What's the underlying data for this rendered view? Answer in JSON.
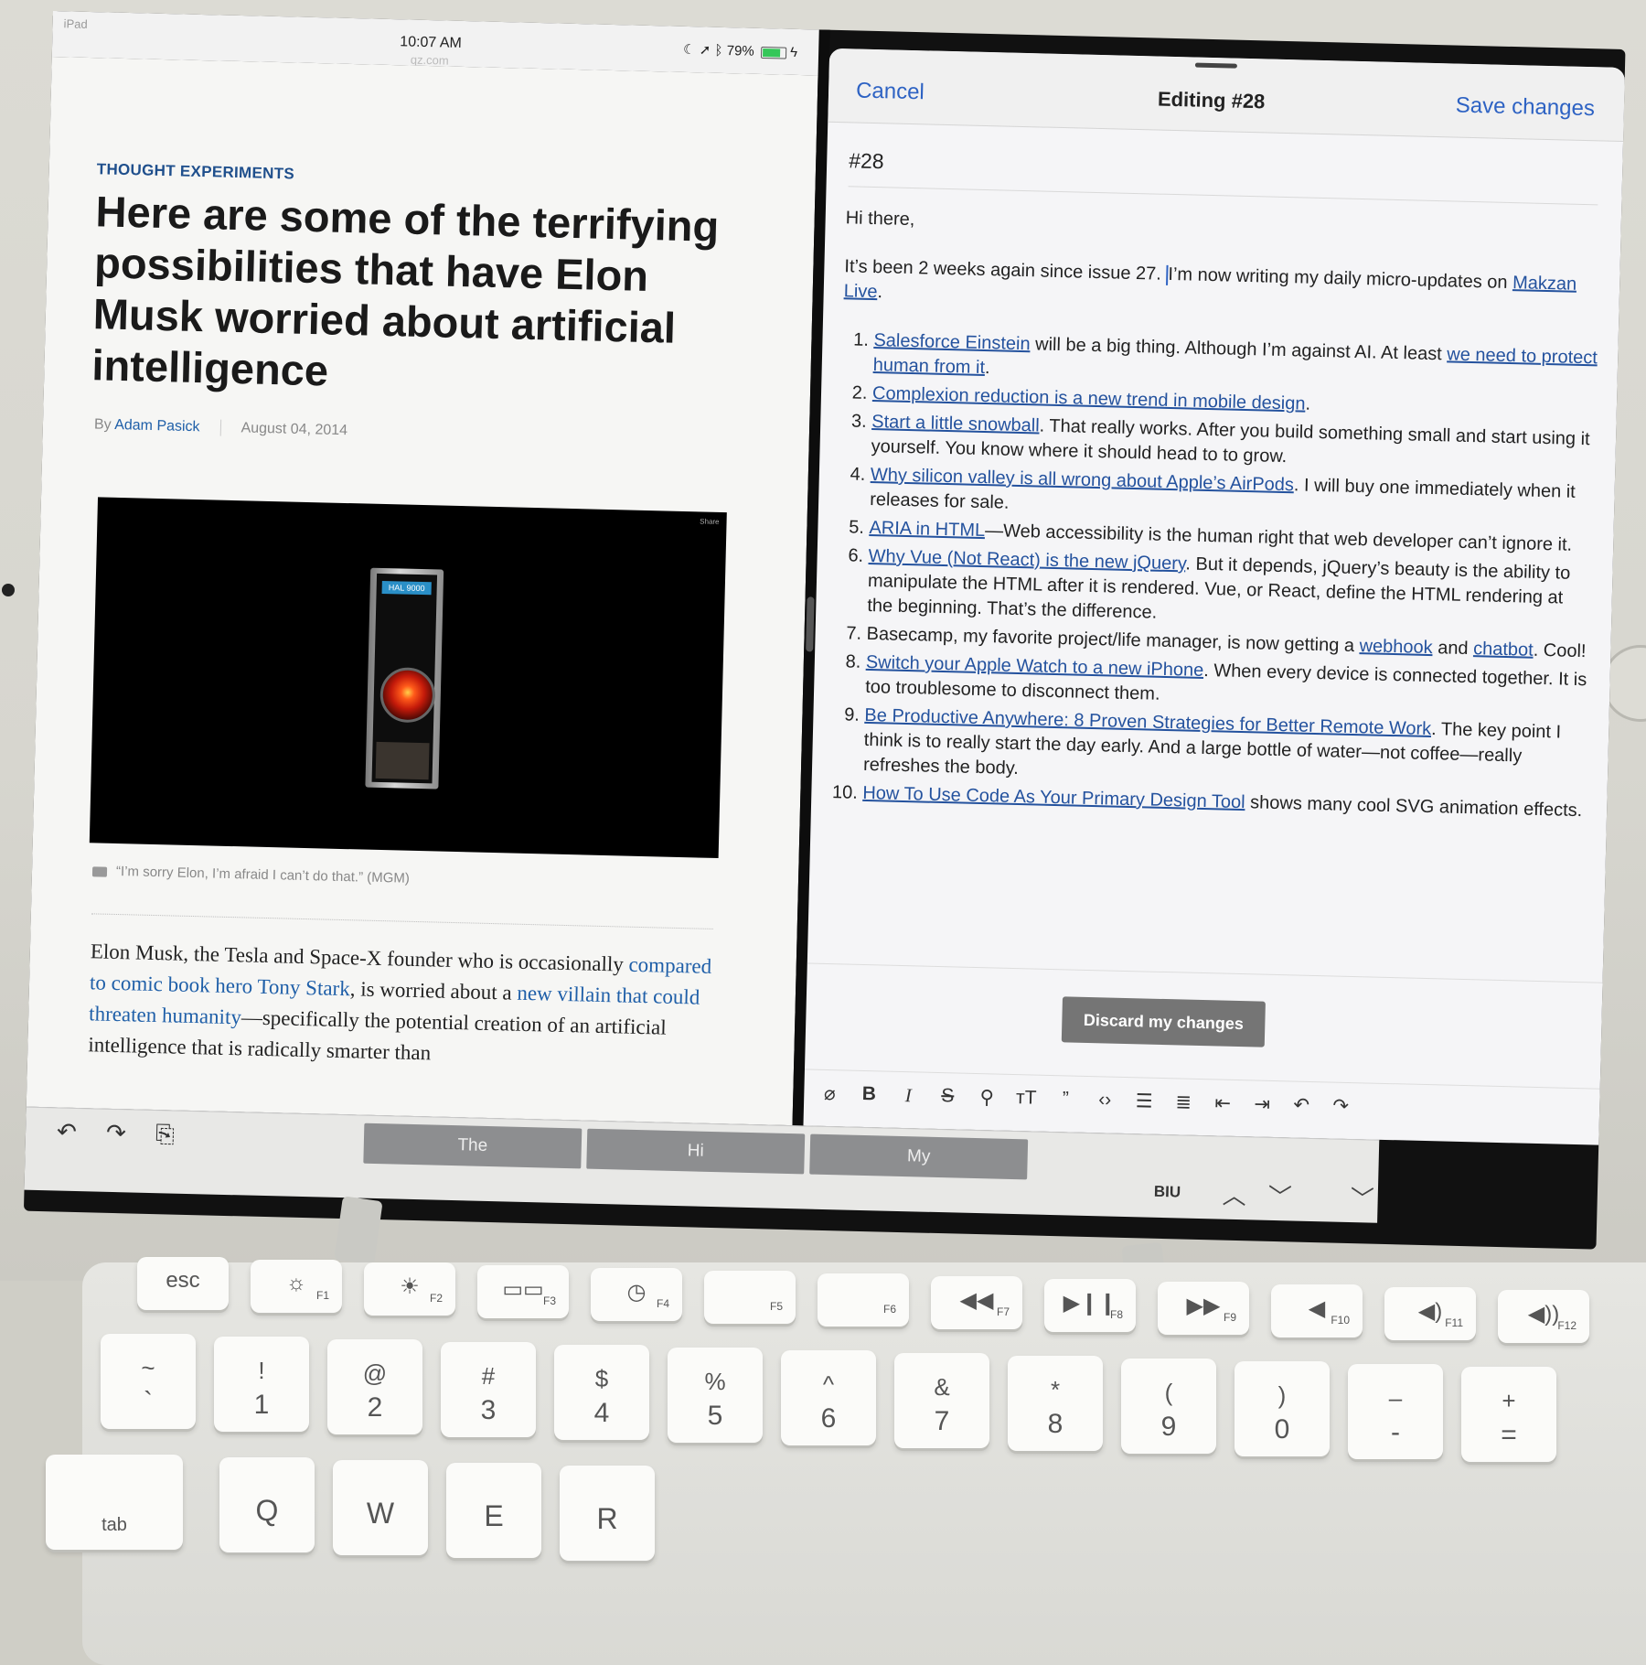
{
  "status_bar": {
    "device_label": "iPad",
    "time": "10:07 AM",
    "url_fragment": "qz.com",
    "battery": "79%",
    "battery_level": 0.79
  },
  "article": {
    "kicker": "THOUGHT EXPERIMENTS",
    "headline": "Here are some of the terrifying possibilities that have Elon Musk worried about artificial intelligence",
    "by_prefix": "By",
    "author": "Adam Pasick",
    "date": "August 04, 2014",
    "image_share": "Share",
    "image_label": "HAL 9000",
    "caption": "“I’m sorry Elon, I’m afraid I can’t do that.” (MGM)",
    "body": {
      "t1": "Elon Musk, the Tesla and Space-X founder who is occasionally ",
      "l1": "compared to comic book hero Tony Stark",
      "t2": ", is worried about a ",
      "l2": "new villain that could threaten humanity",
      "t3": "—specifically the potential creation of an artificial intelligence that is radically smarter than"
    }
  },
  "bottom_bar": {
    "undo_icon": "↶",
    "redo_icon": "↷",
    "paste_icon": "⎘",
    "suggestions": [
      "The",
      "Hi",
      "My"
    ],
    "biu": "BIU",
    "up_icon": "︿",
    "down_icon": "﹀",
    "dismiss_icon": "﹀"
  },
  "editor": {
    "cancel": "Cancel",
    "title": "Editing #28",
    "save": "Save changes",
    "issue": "#28",
    "greeting": "Hi there,",
    "intro_before_caret": "It’s been 2 weeks again since issue 27. ",
    "intro_after_caret": "I’m now writing my daily micro-updates on ",
    "intro_link": "Makzan Live",
    "intro_end": ".",
    "items": [
      {
        "link": "Salesforce Einstein",
        "mid": " will be a big thing. Although I’m against AI. At least ",
        "link2": "we need to protect human from it",
        "end": "."
      },
      {
        "link": "Complexion reduction is a new trend in mobile design",
        "end": "."
      },
      {
        "link": "Start a little snowball",
        "end": ". That really works. After you build something small and start using it yourself. You know where it should head to to grow."
      },
      {
        "link": "Why silicon valley is all wrong about Apple’s AirPods",
        "end": ". I will buy one immediately when it releases for sale."
      },
      {
        "link": "ARIA in HTML",
        "end": "—Web accessibility is the human right that web developer can’t ignore it."
      },
      {
        "link": "Why Vue (Not React) is the new jQuery",
        "end": ". But it depends, jQuery’s beauty is the ability to manipulate the HTML after it is rendered. Vue, or React, define the HTML rendering at the beginning. That’s the difference."
      },
      {
        "pre": "Basecamp, my favorite project/life manager, is now getting a ",
        "link": "webhook",
        "mid": " and ",
        "link2": "chatbot",
        "end": ". Cool!"
      },
      {
        "link": "Switch your Apple Watch to a new iPhone",
        "end": ". When every device is connected together. It is too troublesome to disconnect them."
      },
      {
        "link": "Be Productive Anywhere: 8 Proven Strategies for Better Remote Work",
        "end": ". The key point I think is to really start the day early. And a large bottle of water—not coffee—really refreshes the body."
      },
      {
        "link": "How To Use Code As Your Primary Design Tool",
        "end": " shows many cool SVG animation effects."
      }
    ],
    "discard": "Discard my changes",
    "format_icons": {
      "attach": "⌀",
      "bold": "B",
      "italic": "I",
      "strike": "S",
      "link": "⚲",
      "heading": "тT",
      "quote": "”",
      "code": "‹›",
      "bullets": "☰",
      "numbers": "≣",
      "outdent": "⇤",
      "indent": "⇥",
      "undo": "↶",
      "redo": "↷"
    }
  },
  "keyboard": {
    "fn_row": [
      {
        "glyph": "esc",
        "fn": ""
      },
      {
        "glyph": "☼",
        "fn": "F1"
      },
      {
        "glyph": "☀",
        "fn": "F2"
      },
      {
        "glyph": "▭▭",
        "fn": "F3"
      },
      {
        "glyph": "◷",
        "fn": "F4"
      },
      {
        "glyph": "",
        "fn": "F5"
      },
      {
        "glyph": "",
        "fn": "F6"
      },
      {
        "glyph": "◀◀",
        "fn": "F7"
      },
      {
        "glyph": "▶❙❙",
        "fn": "F8"
      },
      {
        "glyph": "▶▶",
        "fn": "F9"
      },
      {
        "glyph": "◀",
        "fn": "F10"
      },
      {
        "glyph": "◀)",
        "fn": "F11"
      },
      {
        "glyph": "◀))",
        "fn": "F12"
      }
    ],
    "num_row": [
      {
        "sym": "~",
        "num": "`"
      },
      {
        "sym": "!",
        "num": "1"
      },
      {
        "sym": "@",
        "num": "2"
      },
      {
        "sym": "#",
        "num": "3"
      },
      {
        "sym": "$",
        "num": "4"
      },
      {
        "sym": "%",
        "num": "5"
      },
      {
        "sym": "^",
        "num": "6"
      },
      {
        "sym": "&",
        "num": "7"
      },
      {
        "sym": "*",
        "num": "8"
      },
      {
        "sym": "(",
        "num": "9"
      },
      {
        "sym": ")",
        "num": "0"
      },
      {
        "sym": "–",
        "num": "-"
      },
      {
        "sym": "+",
        "num": "="
      }
    ],
    "letter_row": [
      "tab",
      "Q",
      "W",
      "E",
      "R"
    ]
  }
}
